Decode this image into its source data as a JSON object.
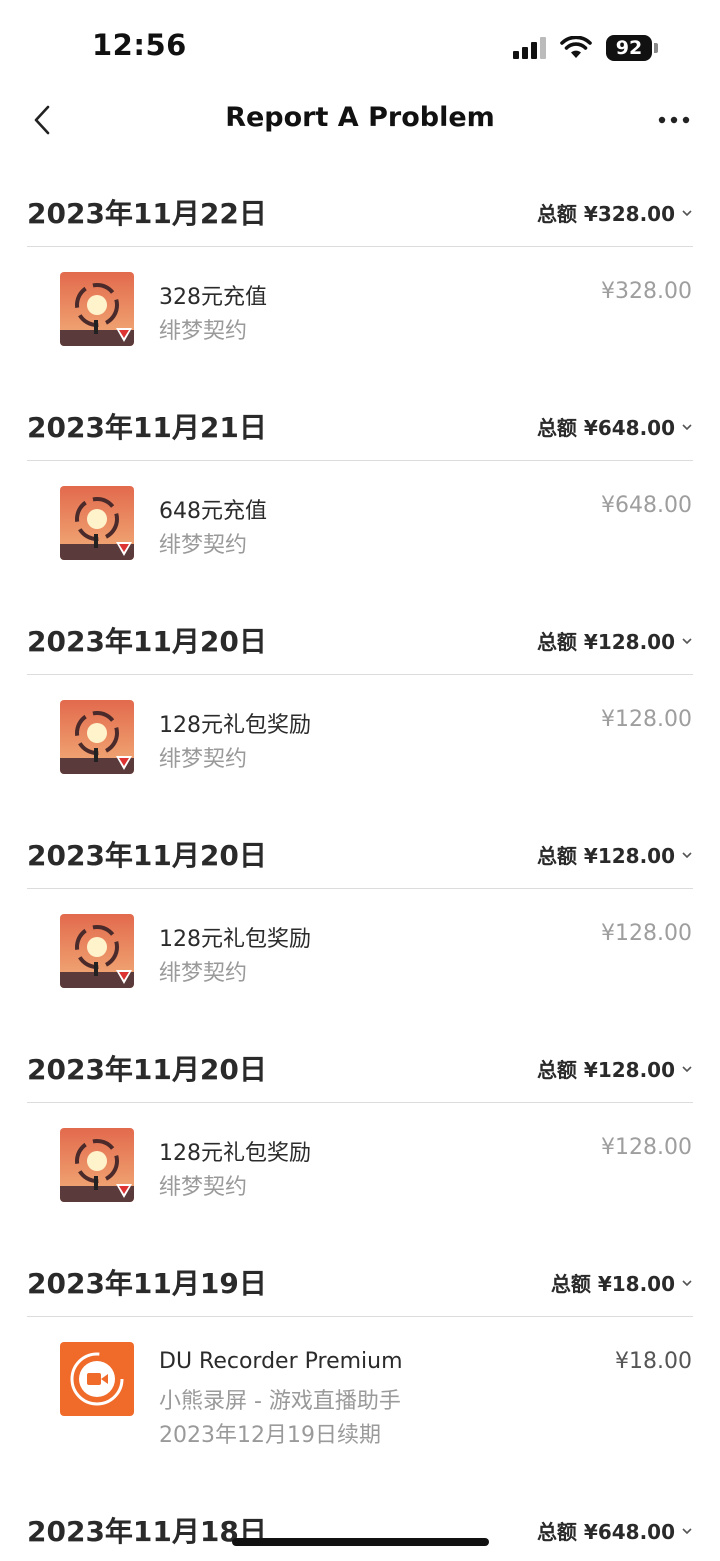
{
  "status_bar": {
    "time": "12:56",
    "battery": "92",
    "icons": [
      "signal-icon",
      "wifi-icon",
      "battery-icon"
    ]
  },
  "nav": {
    "title": "Report A Problem",
    "back_icon": "chevron-left-icon",
    "more_icon": "more-horizontal-icon"
  },
  "groups": [
    {
      "date": "2023年11月22日",
      "total": "总额 ¥328.00",
      "item": {
        "icon": "game-icon-feimeng",
        "name": "328元充值",
        "app": "绯梦契约",
        "renew": "",
        "price": "¥328.00"
      }
    },
    {
      "date": "2023年11月21日",
      "total": "总额 ¥648.00",
      "item": {
        "icon": "game-icon-feimeng",
        "name": "648元充值",
        "app": "绯梦契约",
        "renew": "",
        "price": "¥648.00"
      }
    },
    {
      "date": "2023年11月20日",
      "total": "总额 ¥128.00",
      "item": {
        "icon": "game-icon-feimeng",
        "name": "128元礼包奖励",
        "app": "绯梦契约",
        "renew": "",
        "price": "¥128.00"
      }
    },
    {
      "date": "2023年11月20日",
      "total": "总额 ¥128.00",
      "item": {
        "icon": "game-icon-feimeng",
        "name": "128元礼包奖励",
        "app": "绯梦契约",
        "renew": "",
        "price": "¥128.00"
      }
    },
    {
      "date": "2023年11月20日",
      "total": "总额 ¥128.00",
      "item": {
        "icon": "game-icon-feimeng",
        "name": "128元礼包奖励",
        "app": "绯梦契约",
        "renew": "",
        "price": "¥128.00"
      }
    },
    {
      "date": "2023年11月19日",
      "total": "总额 ¥18.00",
      "item": {
        "icon": "du-recorder-icon",
        "name": "DU Recorder Premium",
        "app": "小熊录屏 - 游戏直播助手",
        "renew": "2023年12月19日续期",
        "price": "¥18.00"
      }
    },
    {
      "date": "2023年11月18日",
      "total": "总额 ¥648.00"
    }
  ],
  "colors": {
    "text_primary": "#2a2a2a",
    "text_secondary": "#9a9a9a",
    "divider": "#dcdcdc",
    "du_orange": "#f06a2a",
    "game_orange": "#e9784f"
  }
}
